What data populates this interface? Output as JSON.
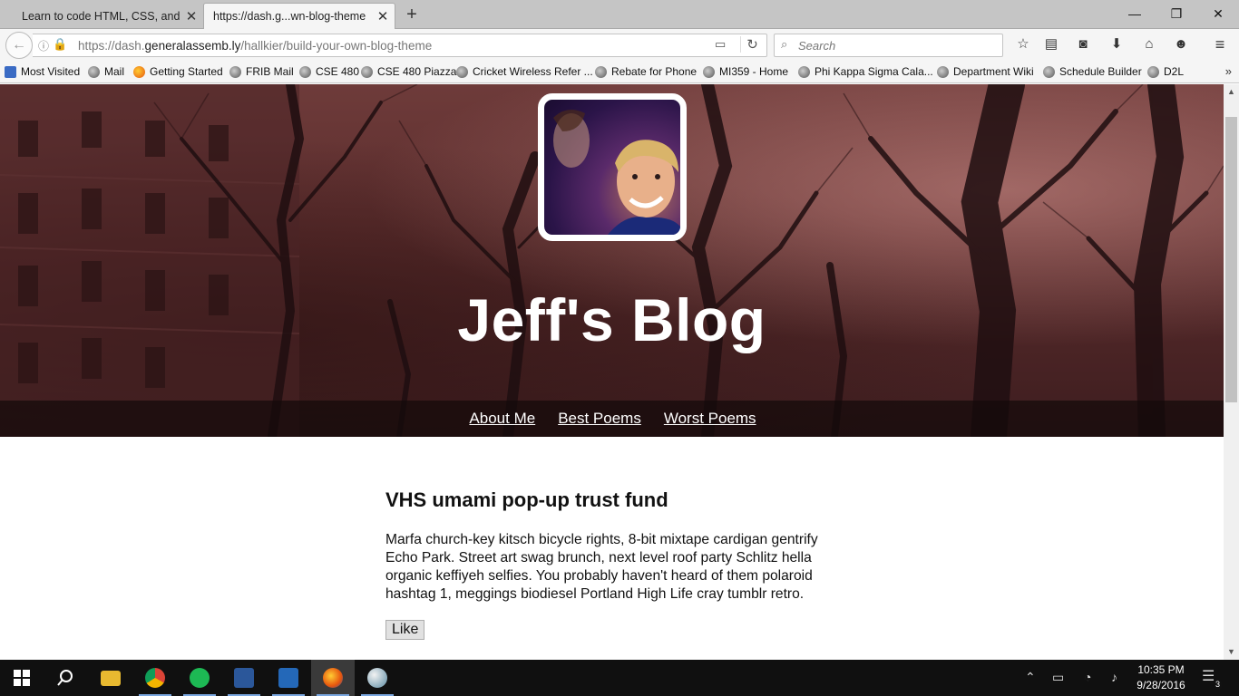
{
  "browser": {
    "tabs": [
      {
        "title": "Learn to code HTML, CSS, and...",
        "active": false
      },
      {
        "title": "https://dash.g...wn-blog-theme",
        "active": true
      }
    ],
    "url_prefix": "https://dash.",
    "url_domain": "generalassemb.ly",
    "url_path": "/hallkier/build-your-own-blog-theme",
    "search_placeholder": "Search",
    "bookmarks": [
      "Most Visited",
      "Mail",
      "Getting Started",
      "FRIB Mail",
      "CSE 480",
      "CSE 480 Piazza",
      "Cricket Wireless Refer ...",
      "Rebate for Phone",
      "MI359 - Home",
      "Phi Kappa Sigma Cala...",
      "Department Wiki",
      "Schedule Builder",
      "D2L"
    ]
  },
  "page": {
    "blog_title": "Jeff's Blog",
    "nav": [
      "About Me",
      "Best Poems",
      "Worst Poems"
    ],
    "post": {
      "title": "VHS umami pop-up trust fund",
      "body": "Marfa church-key kitsch bicycle rights, 8-bit mixtape cardigan gentrify Echo Park. Street art swag brunch, next level roof party Schlitz hella organic keffiyeh selfies. You probably haven't heard of them polaroid hashtag 1, meggings biodiesel Portland High Life cray tumblr retro.",
      "like_label": "Like"
    }
  },
  "taskbar": {
    "time": "10:35 PM",
    "date": "9/28/2016",
    "notifications": "3"
  },
  "colors": {
    "hero_tint": "#5a2c2c",
    "nav_strip": "#140a0a",
    "taskbar": "#101010"
  }
}
